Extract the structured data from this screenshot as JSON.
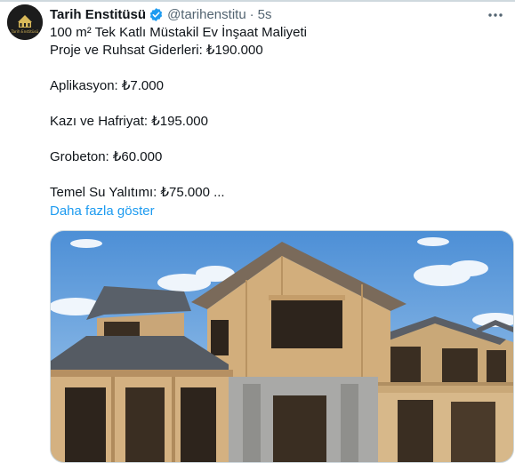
{
  "tweet": {
    "author_name": "Tarih Enstitüsü",
    "handle": "@tarihenstitu",
    "separator": "·",
    "time": "5s",
    "lines": [
      "100 m² Tek Katlı Müstakil Ev İnşaat Maliyeti",
      "Proje ve Ruhsat Giderleri: ₺190.000",
      "",
      "Aplikasyon: ₺7.000",
      "",
      "Kazı ve Hafriyat: ₺195.000",
      "",
      "Grobeton: ₺60.000",
      "",
      "Temel Su Yalıtımı: ₺75.000  ..."
    ],
    "show_more": "Daha fazla göster",
    "avatar_text": "Tarih Enstitüsü"
  },
  "icons": {
    "verified": "verified-badge-icon",
    "more": "more-options-icon"
  },
  "colors": {
    "link": "#1d9bf0",
    "verified": "#1d9bf0",
    "secondary_text": "#536471",
    "primary_text": "#0f1419"
  }
}
